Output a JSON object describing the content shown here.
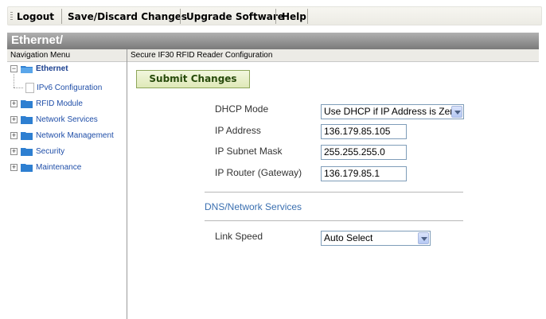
{
  "toolbar": {
    "logout": "Logout",
    "save_discard": "Save/Discard Changes",
    "upgrade": "Upgrade Software",
    "help": "Help"
  },
  "header": {
    "title": "Ethernet/"
  },
  "subheader": {
    "nav_title": "Navigation Menu",
    "config_title": "Secure IF30 RFID Reader Configuration"
  },
  "nav": {
    "ethernet": "Ethernet",
    "ipv6": "IPv6 Configuration",
    "rfid": "RFID Module",
    "network_services": "Network Services",
    "network_management": "Network Management",
    "security": "Security",
    "maintenance": "Maintenance"
  },
  "main": {
    "submit": "Submit Changes",
    "dhcp_label": "DHCP Mode",
    "dhcp_value": "Use DHCP if IP Address is Zero",
    "ip_label": "IP Address",
    "ip_value": "136.179.85.105",
    "mask_label": "IP Subnet Mask",
    "mask_value": "255.255.255.0",
    "router_label": "IP Router (Gateway)",
    "router_value": "136.179.85.1",
    "dns_section": "DNS/Network Services",
    "link_label": "Link Speed",
    "link_value": "Auto Select"
  }
}
